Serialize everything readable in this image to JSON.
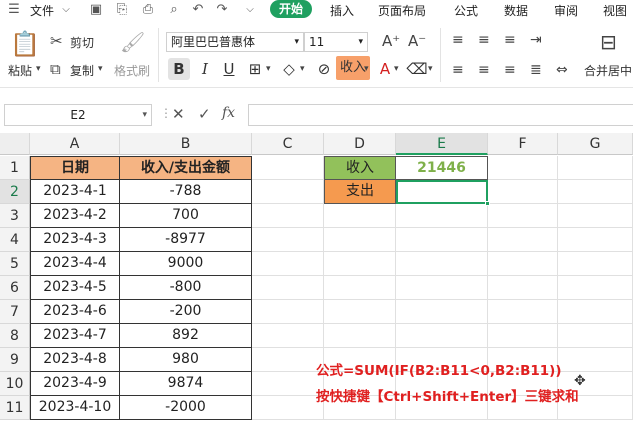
{
  "menubar": {
    "file_label": "文件",
    "tabs": [
      "开始",
      "插入",
      "页面布局",
      "公式",
      "数据",
      "审阅",
      "视图"
    ]
  },
  "ribbon": {
    "paste_label": "粘贴",
    "cut_label": "剪切",
    "copy_label": "复制",
    "format_painter_label": "格式刷",
    "font_name": "阿里巴巴普惠体",
    "font_size": "11",
    "income_button_label": "收入",
    "merge_label": "合并居中"
  },
  "formula_bar": {
    "name_box": "E2",
    "fx_label": "fx",
    "formula": ""
  },
  "grid": {
    "columns": [
      "A",
      "B",
      "C",
      "D",
      "E",
      "F",
      "G"
    ],
    "rows": [
      "1",
      "2",
      "3",
      "4",
      "5",
      "6",
      "7",
      "8",
      "9",
      "10",
      "11"
    ],
    "header_date": "日期",
    "header_amount": "收入/支出金额",
    "dates": [
      "2023-4-1",
      "2023-4-2",
      "2023-4-3",
      "2023-4-4",
      "2023-4-5",
      "2023-4-6",
      "2023-4-7",
      "2023-4-8",
      "2023-4-9",
      "2023-4-10"
    ],
    "amounts": [
      "-788",
      "700",
      "-8977",
      "9000",
      "-800",
      "-200",
      "892",
      "980",
      "9874",
      "-2000"
    ],
    "income_label": "收入",
    "income_value": "21446",
    "expense_label": "支出",
    "expense_value": ""
  },
  "note": {
    "line1": "公式=SUM(IF(B2:B11<0,B2:B11))",
    "line2": "按快捷键【Ctrl+Shift+Enter】三键求和"
  },
  "colors": {
    "accent": "#1fa060",
    "header_orange": "#f5b483",
    "income_green": "#92c15b",
    "expense_orange": "#f59a4f",
    "note_red": "#e02020"
  }
}
